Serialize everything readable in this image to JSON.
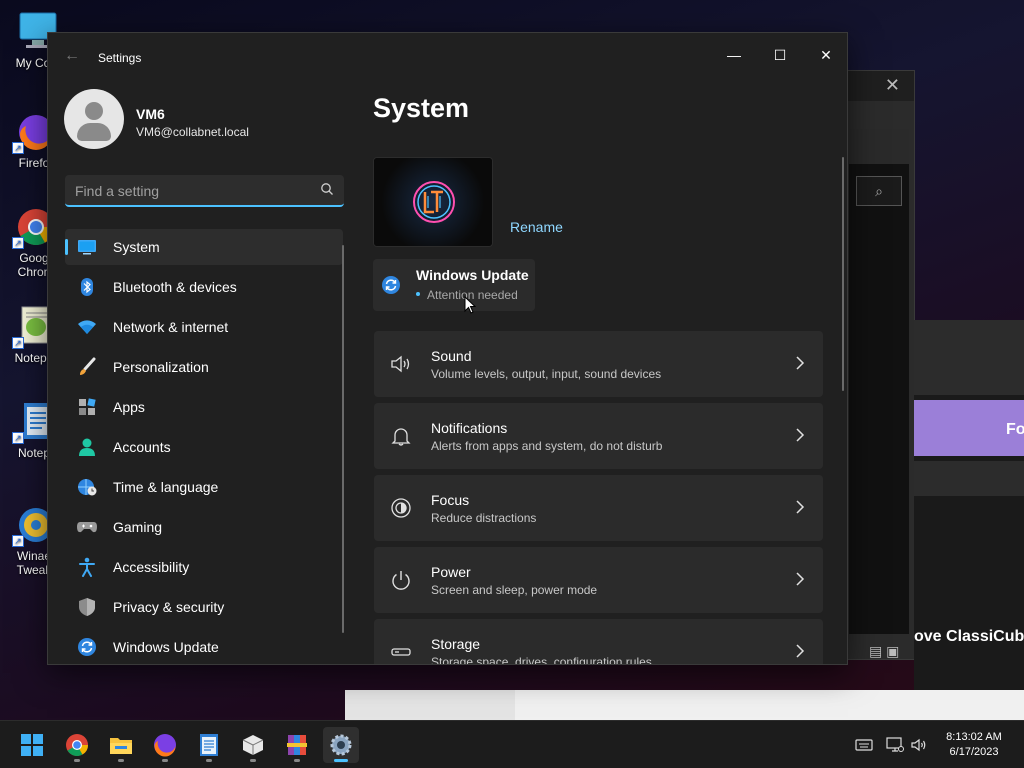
{
  "desktop": {
    "icons": [
      {
        "label": "My Com",
        "icon": "monitor-icon"
      },
      {
        "label": "Firefo",
        "icon": "firefox-icon"
      },
      {
        "label": "Goog Chron",
        "icon": "chrome-icon"
      },
      {
        "label": "Notepa",
        "icon": "notepad-plus-icon"
      },
      {
        "label": "Notep",
        "icon": "notepad-icon"
      },
      {
        "label": "Winae Tweak",
        "icon": "winaero-tweaker-icon"
      }
    ],
    "background_window": {
      "close_glyph": "✕",
      "search_glyph": "⌕"
    },
    "browser_fragment": {
      "banner_text": "Fo",
      "headline": "ove ClassiCub"
    }
  },
  "settings": {
    "app_title": "Settings",
    "window_controls": {
      "minimize": "—",
      "maximize": "☐",
      "close": "✕"
    },
    "profile": {
      "name": "VM6",
      "email": "VM6@collabnet.local"
    },
    "search": {
      "placeholder": "Find a setting"
    },
    "nav": [
      {
        "label": "System",
        "icon": "system-monitor-icon",
        "active": true
      },
      {
        "label": "Bluetooth & devices",
        "icon": "bluetooth-icon"
      },
      {
        "label": "Network & internet",
        "icon": "wifi-icon"
      },
      {
        "label": "Personalization",
        "icon": "brush-icon"
      },
      {
        "label": "Apps",
        "icon": "apps-icon"
      },
      {
        "label": "Accounts",
        "icon": "person-icon"
      },
      {
        "label": "Time & language",
        "icon": "globe-clock-icon"
      },
      {
        "label": "Gaming",
        "icon": "gamepad-icon"
      },
      {
        "label": "Accessibility",
        "icon": "accessibility-icon"
      },
      {
        "label": "Privacy & security",
        "icon": "shield-icon"
      },
      {
        "label": "Windows Update",
        "icon": "update-icon"
      }
    ],
    "main": {
      "title": "System",
      "rename_label": "Rename",
      "windows_update": {
        "title": "Windows Update",
        "status": "Attention needed"
      },
      "cards": [
        {
          "title": "Sound",
          "desc": "Volume levels, output, input, sound devices",
          "icon": "speaker-icon"
        },
        {
          "title": "Notifications",
          "desc": "Alerts from apps and system, do not disturb",
          "icon": "bell-icon"
        },
        {
          "title": "Focus",
          "desc": "Reduce distractions",
          "icon": "focus-icon"
        },
        {
          "title": "Power",
          "desc": "Screen and sleep, power mode",
          "icon": "power-icon"
        },
        {
          "title": "Storage",
          "desc": "Storage space, drives, configuration rules",
          "icon": "storage-icon"
        }
      ]
    }
  },
  "taskbar": {
    "apps": [
      {
        "name": "start",
        "icon": "windows-logo-icon"
      },
      {
        "name": "chrome",
        "icon": "chrome-icon",
        "running": true
      },
      {
        "name": "file-explorer",
        "icon": "folder-icon",
        "running": true
      },
      {
        "name": "firefox",
        "icon": "firefox-icon",
        "running": true
      },
      {
        "name": "notepad",
        "icon": "notepad-icon",
        "running": true
      },
      {
        "name": "package",
        "icon": "package-icon",
        "running": true
      },
      {
        "name": "winrar",
        "icon": "winrar-icon",
        "running": true
      },
      {
        "name": "settings",
        "icon": "gear-icon",
        "running": true,
        "active": true
      }
    ],
    "tray": [
      "keyboard-icon",
      "network-icon",
      "volume-icon"
    ],
    "clock": {
      "time": "8:13:02 AM",
      "date": "6/17/2023"
    }
  },
  "colors": {
    "accent": "#4cc2ff",
    "window_bg": "#202020",
    "card_bg": "#2b2b2b",
    "taskbar_bg": "#1c1c1c"
  }
}
